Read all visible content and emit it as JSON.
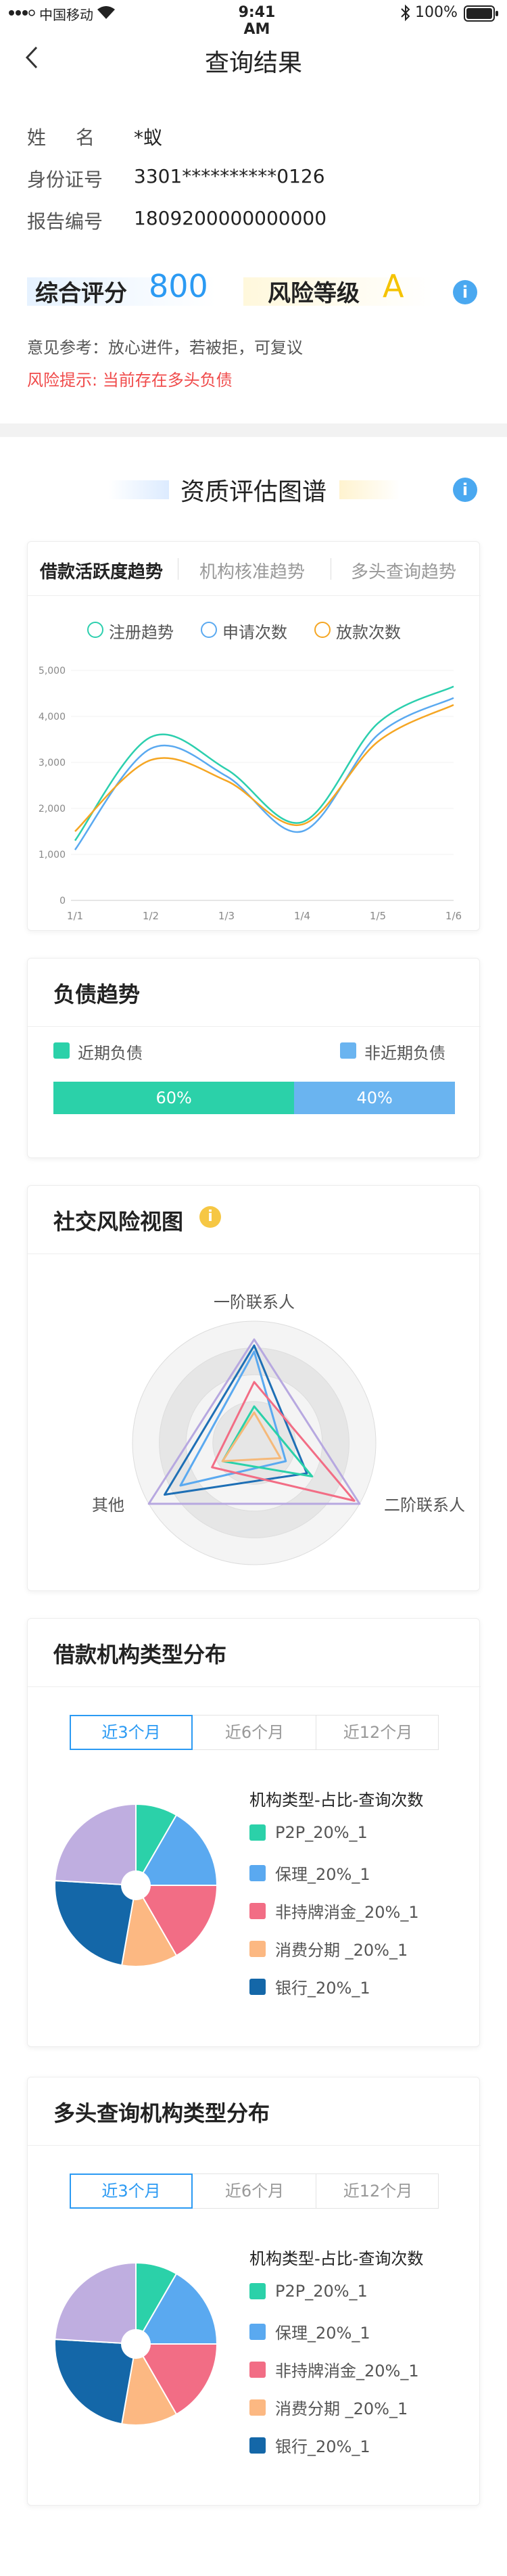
{
  "status": {
    "carrier": "中国移动",
    "time": "9:41 AM",
    "battery": "100%"
  },
  "nav": {
    "title": "查询结果"
  },
  "profile": {
    "name_label": "姓　名",
    "name_value": "*蚁",
    "id_label": "身份证号",
    "id_value": "3301**********0126",
    "report_label": "报告编号",
    "report_value": "1809200000000000"
  },
  "score": {
    "score_label": "综合评分",
    "score_value": "800",
    "risk_label": "风险等级",
    "risk_value": "A",
    "opinion": "意见参考：放心进件，若被拒，可复议",
    "warning": "风险提示: 当前存在多头负债",
    "colors": {
      "score": "#2b9af3",
      "risk": "#f5c300",
      "warning": "#f04a4a"
    }
  },
  "section": {
    "title": "资质评估图谱"
  },
  "trend_card": {
    "tabs": [
      "借款活跃度趋势",
      "机构核准趋势",
      "多头查询趋势"
    ],
    "active_tab": 0
  },
  "chart_data": [
    {
      "type": "line",
      "x": [
        "1/1",
        "1/2",
        "1/3",
        "1/4",
        "1/5",
        "1/6"
      ],
      "ylim": [
        0,
        5000
      ],
      "yticks": [
        "0",
        "1,000",
        "2,000",
        "3,000",
        "4,000",
        "5,000"
      ],
      "series": [
        {
          "name": "注册趋势",
          "color": "#2ccfae",
          "values": [
            1300,
            3550,
            2850,
            1700,
            3850,
            4650
          ]
        },
        {
          "name": "申请次数",
          "color": "#5aa9f0",
          "values": [
            1100,
            3300,
            2700,
            1500,
            3600,
            4400
          ]
        },
        {
          "name": "放款次数",
          "color": "#f5a623",
          "values": [
            1500,
            3050,
            2600,
            1650,
            3450,
            4250
          ]
        }
      ]
    },
    {
      "type": "bar",
      "title": "负债趋势",
      "categories": [
        "近期负债",
        "非近期负债"
      ],
      "values": [
        60,
        40
      ],
      "labels": [
        "60%",
        "40%"
      ],
      "colors": [
        "#2bd1a9",
        "#6ab4f0"
      ]
    },
    {
      "type": "radar",
      "title": "社交风险视图",
      "axes": [
        "一阶联系人",
        "二阶联系人",
        "其他"
      ],
      "series": [
        {
          "color": "#b7a8e0",
          "values": [
            0.85,
            1.0,
            1.0
          ]
        },
        {
          "color": "#1e6fb5",
          "values": [
            0.8,
            0.5,
            0.85
          ]
        },
        {
          "color": "#5aa9f0",
          "values": [
            0.75,
            0.3,
            0.7
          ]
        },
        {
          "color": "#f26d85",
          "values": [
            0.5,
            0.95,
            0.4
          ]
        },
        {
          "color": "#2bd1a9",
          "values": [
            0.3,
            0.55,
            0.3
          ]
        },
        {
          "color": "#f5b97a",
          "values": [
            0.25,
            0.25,
            0.3
          ]
        }
      ]
    },
    {
      "type": "pie",
      "title": "借款机构类型分布",
      "tabs": [
        "近3个月",
        "近6个月",
        "近12个月"
      ],
      "active_tab": 0,
      "legend_title": "机构类型-占比-查询次数",
      "categories": [
        "P2P_20%_1",
        "保理_20%_1",
        "非持牌消金_20%_1",
        "消费分期 _20%_1",
        "银行_20%_1"
      ],
      "slice_values": [
        9,
        18,
        18,
        12,
        25,
        26
      ],
      "slice_colors": [
        "#2bd1a9",
        "#5aa9f0",
        "#f26d85",
        "#fcb882",
        "#1467a8",
        "#bfaee0"
      ],
      "legend_colors": [
        "#2bd1a9",
        "#5aa9f0",
        "#f26d85",
        "#fcb882",
        "#1467a8"
      ]
    },
    {
      "type": "pie",
      "title": "多头查询机构类型分布",
      "tabs": [
        "近3个月",
        "近6个月",
        "近12个月"
      ],
      "active_tab": 0,
      "legend_title": "机构类型-占比-查询次数",
      "categories": [
        "P2P_20%_1",
        "保理_20%_1",
        "非持牌消金_20%_1",
        "消费分期 _20%_1",
        "银行_20%_1"
      ],
      "slice_values": [
        9,
        18,
        18,
        12,
        25,
        26
      ],
      "slice_colors": [
        "#2bd1a9",
        "#5aa9f0",
        "#f26d85",
        "#fcb882",
        "#1467a8",
        "#bfaee0"
      ],
      "legend_colors": [
        "#2bd1a9",
        "#5aa9f0",
        "#f26d85",
        "#fcb882",
        "#1467a8"
      ]
    }
  ]
}
